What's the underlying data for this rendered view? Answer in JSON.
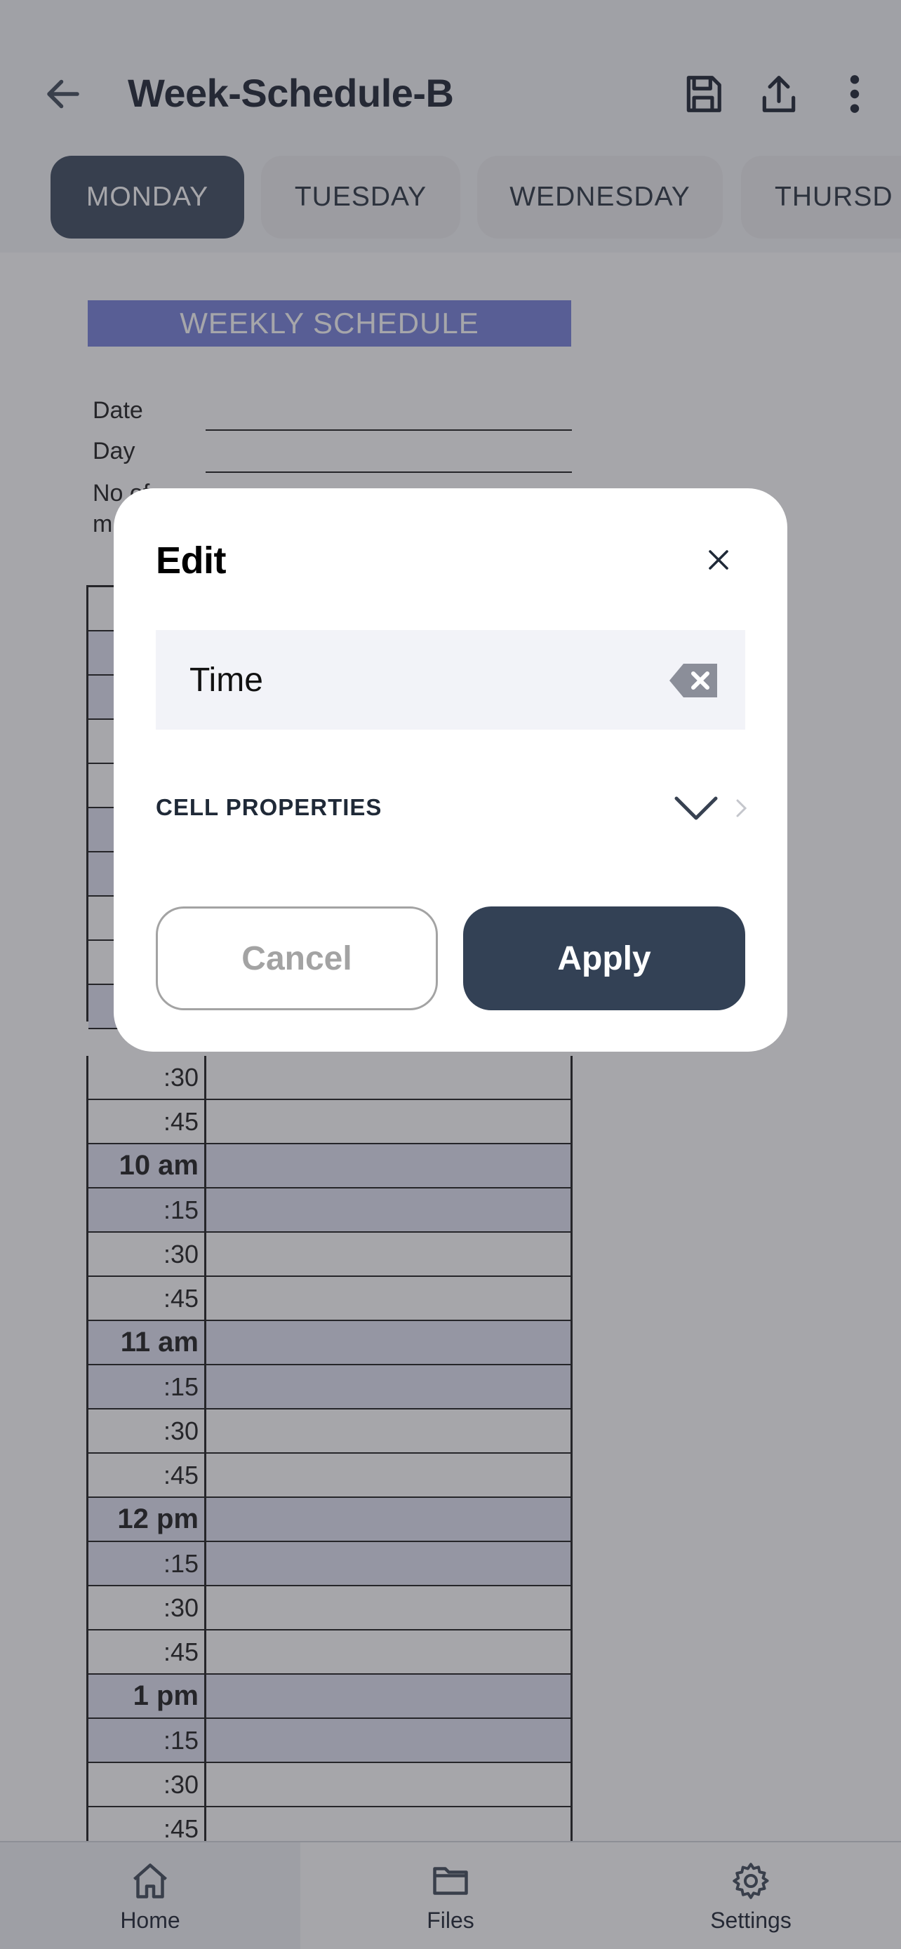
{
  "header": {
    "title": "Week-Schedule-B",
    "back_icon": "arrow-left-icon",
    "actions": [
      "save-icon",
      "share-icon",
      "more-vertical-icon"
    ]
  },
  "tabs": [
    {
      "label": "MONDAY",
      "active": true
    },
    {
      "label": "TUESDAY",
      "active": false
    },
    {
      "label": "WEDNESDAY",
      "active": false
    },
    {
      "label": "THURSD",
      "active": false
    }
  ],
  "document": {
    "banner": "WEEKLY SCHEDULE",
    "fields": {
      "date": "Date",
      "day": "Day",
      "no_of_line1": "No of",
      "no_of_line2": "m"
    },
    "schedule_rows": [
      ":30",
      ":45",
      "10 am",
      ":15",
      ":30",
      ":45",
      "11 am",
      ":15",
      ":30",
      ":45",
      "12 pm",
      ":15",
      ":30",
      ":45",
      "1 pm",
      ":15",
      ":30",
      ":45"
    ]
  },
  "modal": {
    "title": "Edit",
    "input_value": "Time",
    "section_label": "CELL PROPERTIES",
    "cancel_label": "Cancel",
    "apply_label": "Apply"
  },
  "bottom_nav": [
    {
      "label": "Home",
      "icon": "home-icon",
      "active": true
    },
    {
      "label": "Files",
      "icon": "folder-icon",
      "active": false
    },
    {
      "label": "Settings",
      "icon": "gear-icon",
      "active": false
    }
  ],
  "colors": {
    "primary": "#334155",
    "banner": "#6f7bd8",
    "row_highlight": "#dfe1f3",
    "overlay": "rgba(60,62,70,0.46)"
  }
}
